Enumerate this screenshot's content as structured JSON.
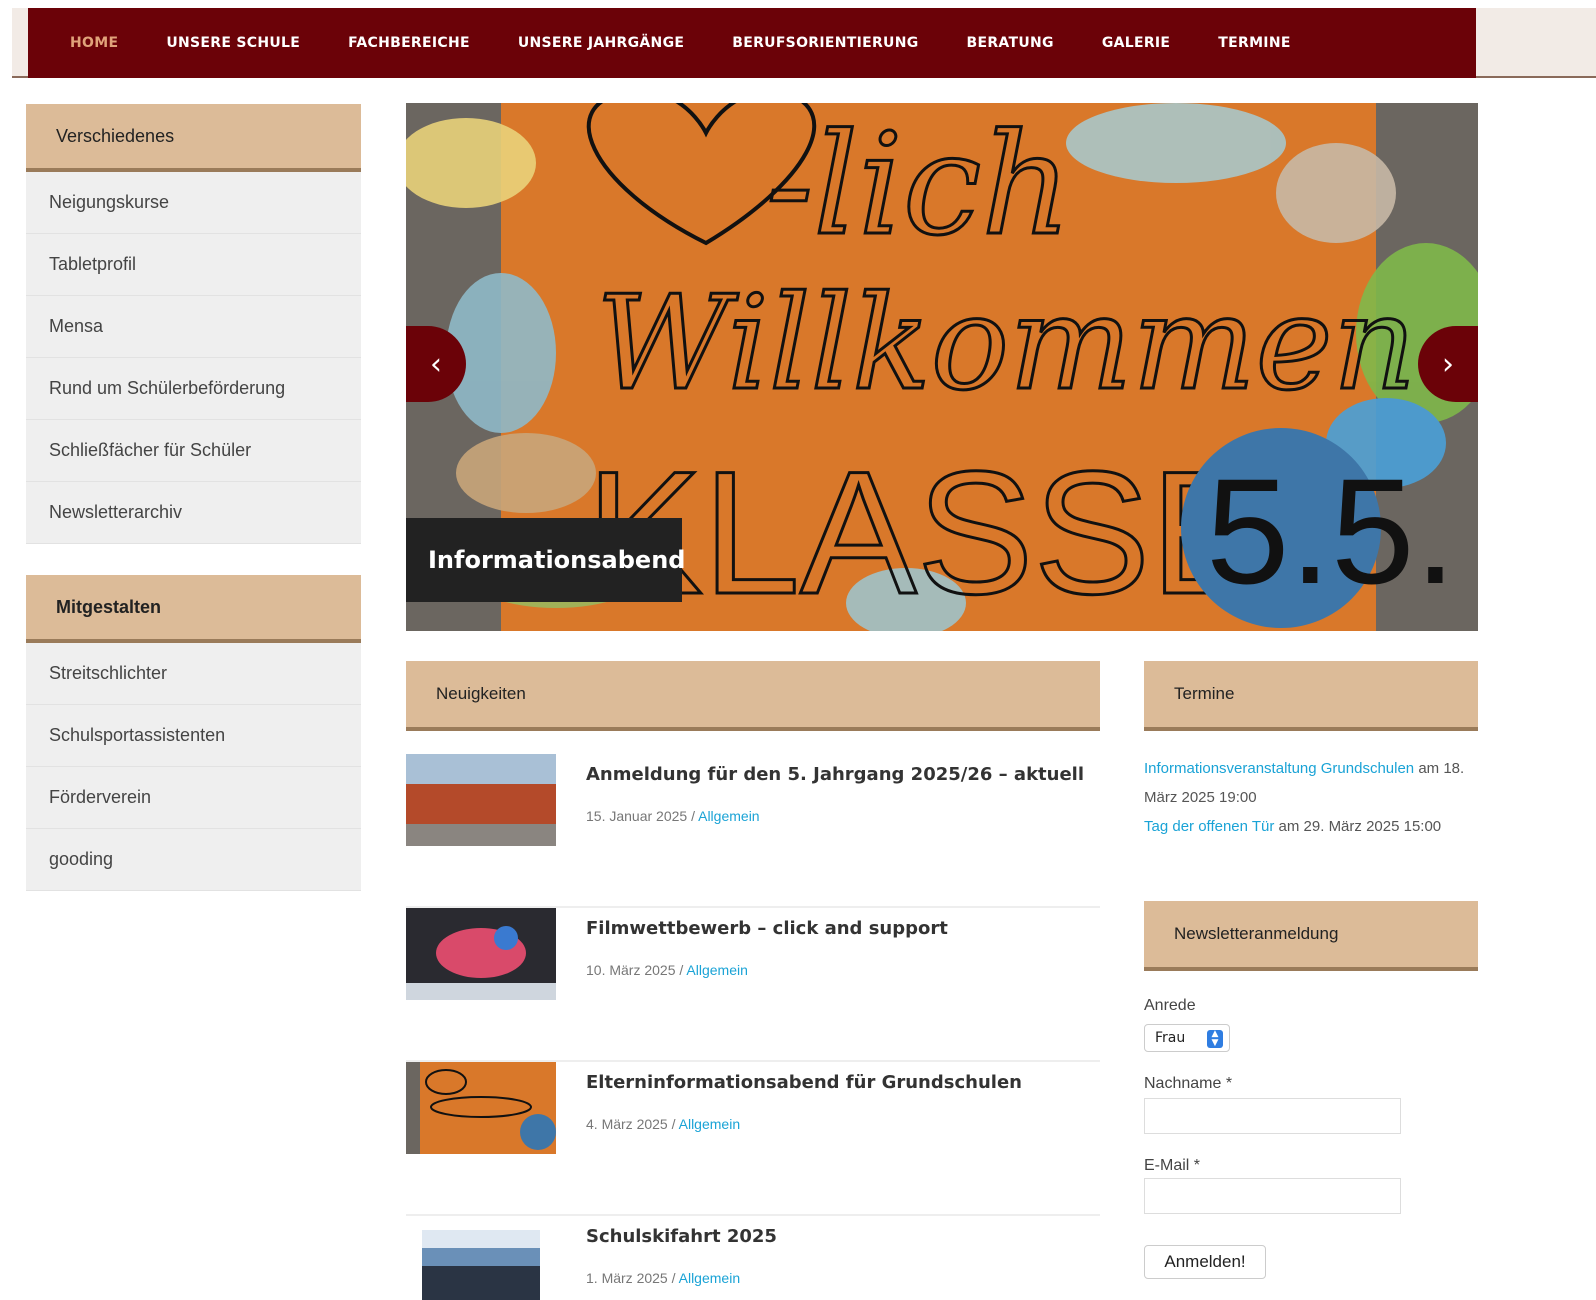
{
  "nav": {
    "items": [
      "Home",
      "Unsere Schule",
      "Fachbereiche",
      "Unsere Jahrgänge",
      "Berufsorientierung",
      "Beratung",
      "Galerie",
      "Termine"
    ]
  },
  "sidebar": {
    "box1": {
      "title": "Verschiedenes",
      "items": [
        "Neigungskurse",
        "Tabletprofil",
        "Mensa",
        "Rund um Schülerbeförderung",
        "Schließfächer für Schüler",
        "Newsletterarchiv"
      ]
    },
    "box2": {
      "title": "Mitgestalten",
      "items": [
        "Streitschlichter",
        "Schulsportassistenten",
        "Förderverein",
        "gooding"
      ]
    }
  },
  "hero": {
    "caption": "Informationsabend",
    "prev": "‹",
    "next": "›",
    "sign_line1": "-lich",
    "sign_line2": "Willkommen",
    "sign_line3": "KLASSE",
    "sign_badge": "5.5."
  },
  "news": {
    "title": "Neuigkeiten",
    "posts": [
      {
        "title": "Anmeldung für den 5. Jahrgang 2025/26 – aktuell",
        "date": "15. Januar 2025",
        "sep": " / ",
        "category": "Allgemein"
      },
      {
        "title": "Filmwettbewerb – click and support",
        "date": "10. März 2025",
        "sep": " / ",
        "category": "Allgemein"
      },
      {
        "title": "Elterninformationsabend für Grundschulen",
        "date": "4. März 2025",
        "sep": " / ",
        "category": "Allgemein"
      },
      {
        "title": "Schulskifahrt 2025",
        "date": "1. März 2025",
        "sep": " / ",
        "category": "Allgemein"
      }
    ]
  },
  "termine": {
    "title": "Termine",
    "event1_link": "Informationsveranstaltung Grundschulen",
    "event1_date": " am 18. März 2025 19:00",
    "event2_link": "Tag der offenen Tür",
    "event2_date": " am 29. März 2025 15:00"
  },
  "newsletter": {
    "title": "Newsletteranmeldung",
    "salutation_label": "Anrede",
    "salutation_value": "Frau",
    "lastname_label": "Nachname *",
    "email_label": "E-Mail *",
    "submit_label": "Anmelden!"
  },
  "colors": {
    "nav_bg": "#6b0208",
    "nav_active": "#e0a27a",
    "box_header": "#dcbb98",
    "link": "#1aa3d6"
  }
}
